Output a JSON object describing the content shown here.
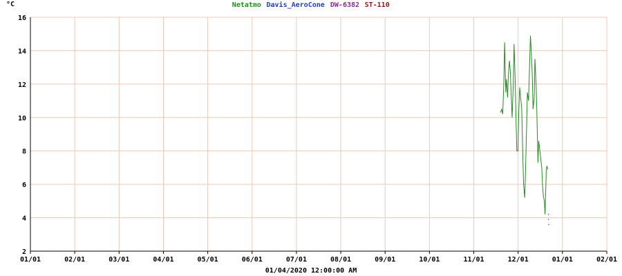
{
  "chart_data": {
    "type": "line",
    "unit_label": "°C",
    "legend": [
      {
        "name": "Netatmo",
        "color": "#228b22"
      },
      {
        "name": "Davis_AeroCone",
        "color": "#1f3fbf"
      },
      {
        "name": "DW-6382",
        "color": "#8b2b8b"
      },
      {
        "name": "ST-110",
        "color": "#8b1a1a"
      }
    ],
    "x_ticks": [
      "01/01",
      "02/01",
      "03/01",
      "04/01",
      "05/01",
      "06/01",
      "07/01",
      "08/01",
      "09/01",
      "10/01",
      "11/01",
      "12/01",
      "01/01",
      "02/01"
    ],
    "y_ticks": [
      "2",
      "4",
      "6",
      "8",
      "10",
      "12",
      "14",
      "16"
    ],
    "ylim": [
      2,
      16
    ],
    "xlim_days": [
      0,
      397
    ],
    "xlabel": "01/04/2020 12:00:00 AM",
    "grid": true,
    "series": [
      {
        "name": "Netatmo",
        "color": "#228b22",
        "points": [
          [
            323.8,
            10.3
          ],
          [
            324.6,
            10.5
          ],
          [
            325.3,
            10.2
          ],
          [
            326.1,
            12.2
          ],
          [
            326.6,
            14.5
          ],
          [
            327.4,
            11.5
          ],
          [
            327.9,
            12.3
          ],
          [
            328.7,
            11.2
          ],
          [
            329.2,
            12.6
          ],
          [
            330.0,
            13.4
          ],
          [
            330.5,
            12.8
          ],
          [
            331.3,
            11.0
          ],
          [
            331.8,
            10.0
          ],
          [
            332.6,
            12.0
          ],
          [
            333.1,
            14.4
          ],
          [
            333.9,
            12.3
          ],
          [
            334.5,
            9.8
          ],
          [
            335.0,
            8.0
          ],
          [
            335.8,
            8.0
          ],
          [
            336.3,
            10.2
          ],
          [
            337.0,
            11.8
          ],
          [
            337.9,
            11.0
          ],
          [
            338.4,
            10.5
          ],
          [
            339.2,
            7.5
          ],
          [
            339.7,
            6.0
          ],
          [
            340.5,
            5.2
          ],
          [
            341.0,
            6.8
          ],
          [
            341.8,
            9.5
          ],
          [
            342.3,
            11.5
          ],
          [
            343.1,
            11.0
          ],
          [
            343.6,
            12.5
          ],
          [
            344.4,
            14.9
          ],
          [
            344.9,
            14.0
          ],
          [
            345.7,
            12.5
          ],
          [
            346.2,
            10.5
          ],
          [
            347.0,
            11.2
          ],
          [
            347.5,
            13.5
          ],
          [
            348.3,
            12.0
          ],
          [
            348.8,
            10.5
          ],
          [
            349.6,
            7.3
          ],
          [
            350.1,
            8.6
          ],
          [
            350.9,
            8.0
          ],
          [
            351.4,
            7.6
          ],
          [
            352.2,
            7.0
          ],
          [
            352.7,
            6.0
          ],
          [
            353.3,
            5.3
          ],
          [
            354.0,
            5.0
          ],
          [
            354.5,
            4.2
          ],
          [
            355.3,
            6.8
          ],
          [
            355.8,
            7.1
          ],
          [
            356.3,
            6.9
          ]
        ]
      }
    ],
    "dots": [
      [
        356.8,
        4.2
      ],
      [
        356.8,
        3.9
      ],
      [
        357.0,
        3.6
      ]
    ]
  }
}
